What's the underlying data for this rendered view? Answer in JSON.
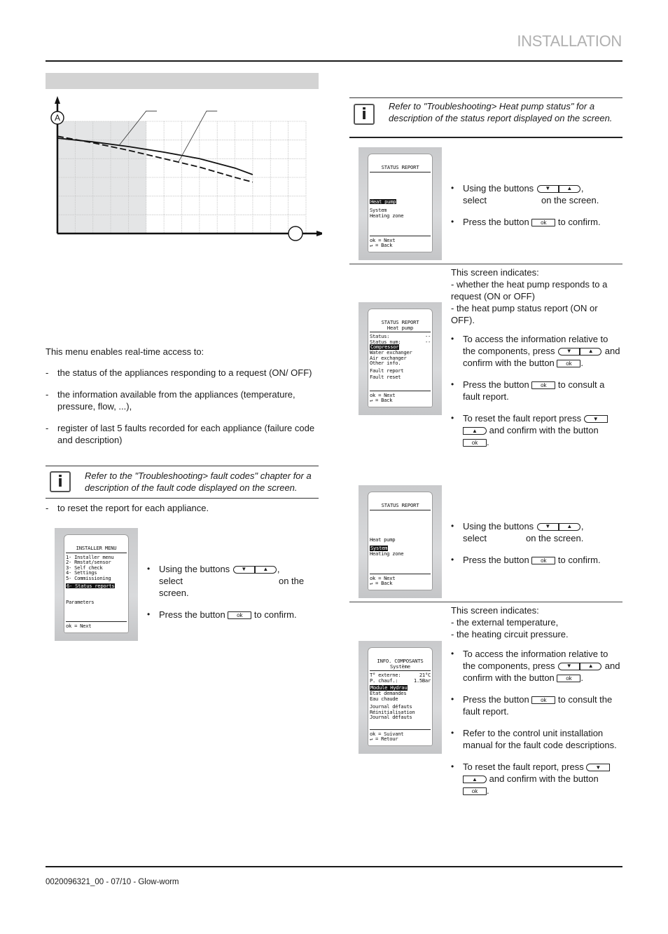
{
  "header": {
    "section_title": "INSTALLATION"
  },
  "left": {
    "chart_data": {
      "type": "line",
      "title": "",
      "xlabel": "",
      "ylabel": "A",
      "x_axis_marker": "",
      "grid": true,
      "x_gridlines": 14,
      "y_gridlines": 6,
      "shaded_region_x": [
        0,
        5
      ],
      "xlim": [
        0,
        14
      ],
      "ylim": [
        0,
        6
      ],
      "series": [
        {
          "name": "solid-curve",
          "style": "solid",
          "x": [
            0,
            2,
            4,
            6,
            8,
            10,
            11
          ],
          "y": [
            5.1,
            4.9,
            4.65,
            4.35,
            4.0,
            3.5,
            3.15
          ]
        },
        {
          "name": "dashed-curve",
          "style": "dashed",
          "x": [
            0,
            2,
            4,
            6,
            8,
            10,
            11
          ],
          "y": [
            5.2,
            4.85,
            4.45,
            4.0,
            3.55,
            3.0,
            2.75
          ]
        }
      ]
    },
    "intro": "This menu enables real-time access to:",
    "access_items": [
      "the status of the appliances responding to a request (ON/ OFF)",
      "the information available from the appliances (temperature, pressure, flow, ...),",
      "register of last 5 faults recorded for each appliance (failure code and description)"
    ],
    "note": "Refer to the \"Troubleshooting> fault codes\" chapter for a description of the fault code displayed on the screen.",
    "reset_item": "to reset the report for each appliance.",
    "installer_screen": {
      "title": "INSTALLER MENU",
      "items": [
        "1- Installer menu",
        "2- Rmstat/sensor",
        "3- Self check",
        "4- Settings",
        "5- Commissioning"
      ],
      "selected": "6- Status reports",
      "extra": "Parameters",
      "footer": "ok  = Next"
    },
    "step1": {
      "using": "Using the buttons",
      "comma": ",",
      "select": "select",
      "on_screen": "on the screen.",
      "press": "Press the button",
      "confirm": "to confirm."
    }
  },
  "right": {
    "note": "Refer to \"Troubleshooting> Heat pump status\" for a description of the status report displayed on the screen.",
    "screen1": {
      "title": "STATUS REPORT",
      "selected": "Heat pump",
      "items": [
        "System",
        "Heating zone"
      ],
      "footer": [
        "ok  = Next",
        "↵   = Back"
      ]
    },
    "step1": {
      "using": "Using the buttons",
      "comma": ",",
      "select": "select",
      "on_screen": "on the screen.",
      "press": "Press the button",
      "confirm": "to confirm."
    },
    "screen2": {
      "title": "STATUS REPORT",
      "subtitle": "Heat pump",
      "status_rows": [
        {
          "label": "Status:",
          "value": "--"
        },
        {
          "label": "Status num:",
          "value": "--"
        }
      ],
      "selected": "Compressor",
      "items": [
        "Water exchanger",
        "Air exchanger",
        "Other info."
      ],
      "items2": [
        "Fault report",
        "Fault reset"
      ],
      "footer": [
        "ok  = Next",
        "↵   = Back"
      ]
    },
    "desc2": {
      "intro": "This screen indicates:",
      "lines": [
        "- whether the heat pump responds to a request (ON or OFF)",
        "- the heat pump status report (ON or OFF)."
      ],
      "b1_a": "To access the information relative to the components, press",
      "b1_b": "and confirm with the button",
      "b2_a": "Press the button",
      "b2_b": "to consult a fault report.",
      "b3_a": "To reset the fault report press",
      "b3_b": "and confirm with the button"
    },
    "screen3": {
      "title": "STATUS REPORT",
      "items_before": [
        "Heat pump"
      ],
      "selected": "System",
      "items": [
        "Heating zone"
      ],
      "footer": [
        "ok  = Next",
        "↵   = Back"
      ]
    },
    "step3": {
      "using": "Using the buttons",
      "comma": ",",
      "select": "select",
      "on_screen": "on the screen.",
      "press": "Press the button",
      "confirm": "to confirm."
    },
    "screen4": {
      "title": "INFO. COMPOSANTS",
      "subtitle": "Système",
      "status_rows": [
        {
          "label": "T° externe:",
          "value": "21°C"
        },
        {
          "label": "P. chauf.:",
          "value": "1.5Bar"
        }
      ],
      "selected": "Module Hydrau",
      "items": [
        "Etat demandes",
        "Eau chaude"
      ],
      "items2": [
        "Journal défauts",
        "Réinitialisation",
        "Journal défauts"
      ],
      "footer": [
        "ok  = Suivant",
        "↵   = Retour"
      ]
    },
    "desc4": {
      "intro": "This screen indicates:",
      "lines": [
        "- the external temperature,",
        "- the heating circuit pressure."
      ],
      "b1_a": "To access the information relative to the components, press",
      "b1_b": "and confirm with the button",
      "b2_a": "Press the button",
      "b2_b": "to consult the fault report.",
      "b3": "Refer to the control unit installation manual for the fault code descriptions.",
      "b4_a": "To reset the fault report, press",
      "b4_b": "and confirm with the button"
    }
  },
  "buttons": {
    "down": "▼",
    "up": "▲",
    "ok": "ok"
  },
  "footer": {
    "doc_ref": "0020096321_00 - 07/10 - Glow-worm"
  }
}
